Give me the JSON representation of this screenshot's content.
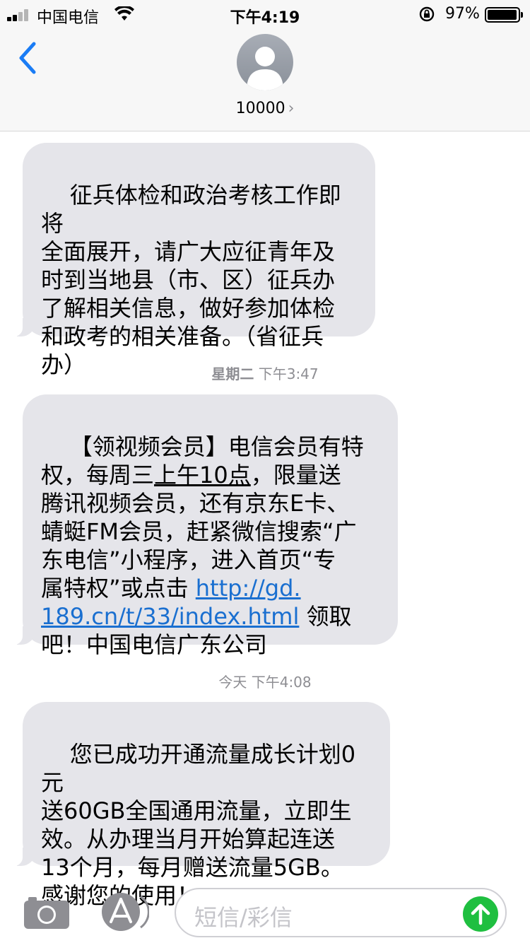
{
  "status_bar": {
    "carrier": "中国电信",
    "time": "下午4:19",
    "battery_percent": "97%"
  },
  "header": {
    "contact": "10000",
    "back_icon": "chevron-left-icon",
    "avatar_icon": "person-silhouette-icon"
  },
  "messages": [
    {
      "text": "征兵体检和政治考核工作即将\n全面展开，请广大应征青年及\n时到当地县（市、区）征兵办\n了解相关信息，做好参加体检\n和政考的相关准备。（省征兵\n办）"
    },
    {
      "timestamp_day": "星期二",
      "timestamp_time": "下午3:47"
    },
    {
      "text_before": "【领视频会员】电信会员有特\n权，每周三",
      "text_underlined": "上午10点",
      "text_mid": "，限量送\n腾讯视频会员，还有京东E卡、\n蜻蜓FM会员，赶紧微信搜索“广\n东电信”小程序，进入首页“专\n属特权”或点击 ",
      "link": "http://gd.\n189.cn/t/33/index.html",
      "text_after": " 领取\n吧！中国电信广东公司"
    },
    {
      "timestamp_day": "今天",
      "timestamp_time": "下午4:08"
    },
    {
      "text": "您已成功开通流量成长计划0元\n送60GB全国通用流量，立即生\n效。从办理当月开始算起连送\n13个月，每月赠送流量5GB。\n感谢您的使用！"
    }
  ],
  "compose": {
    "placeholder": "短信/彩信",
    "camera_icon": "camera-icon",
    "apps_icon": "app-store-icon",
    "send_icon": "arrow-up-icon"
  },
  "colors": {
    "bubble": "#e5e5ea",
    "link": "#1a6fd0",
    "accent": "#1a7cf5",
    "send": "#1fbf40"
  }
}
